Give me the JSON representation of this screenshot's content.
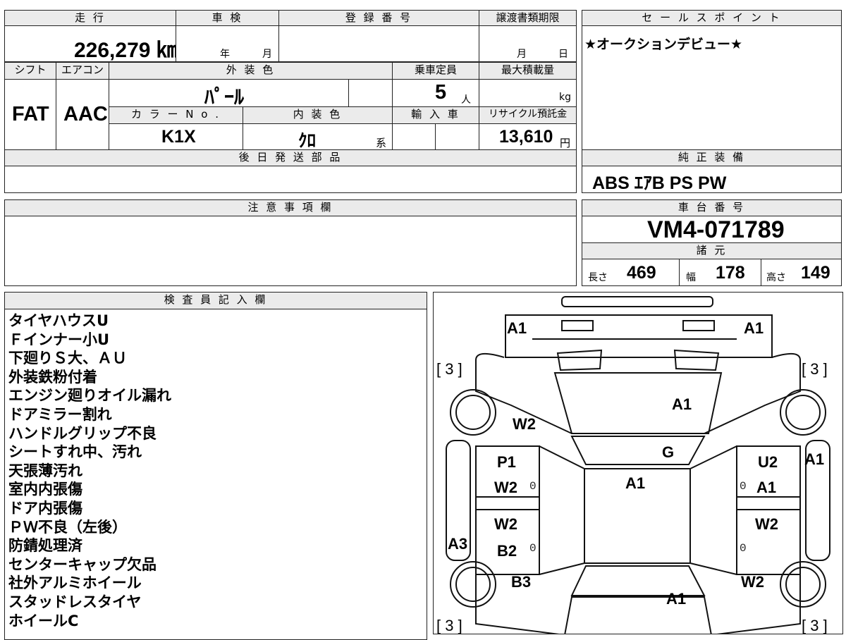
{
  "headers": {
    "mileage": "走 行",
    "inspection": "車 検",
    "registration": "登 録 番 号",
    "transfer_deadline": "譲渡書類期限",
    "sales_point": "セ ー ル ス ポ イ ン ト",
    "shift": "シフト",
    "aircon": "エアコン",
    "exterior_color": "外 装 色",
    "capacity": "乗車定員",
    "max_load": "最大積載量",
    "color_no": "カ ラ ー N o .",
    "interior_color": "内 装 色",
    "import": "輸 入 車",
    "recycle": "リサイクル預託金",
    "later_parts": "後 日 発 送 部 品",
    "genuine_equipment": "純 正 装 備",
    "notes": "注 意 事 項 欄",
    "chassis_no": "車 台 番 号",
    "specs": "諸 元",
    "inspector": "検 査 員 記 入 欄"
  },
  "vehicle": {
    "mileage": "226,279 ㎞",
    "inspection_year_unit": "年",
    "inspection_month_unit": "月",
    "deadline_month_unit": "月",
    "deadline_day_unit": "日",
    "shift": "FAT",
    "aircon": "AAC",
    "exterior_color": "ﾊﾟｰﾙ",
    "capacity": "5",
    "capacity_unit": "人",
    "max_load_unit": "kg",
    "color_no": "K1X",
    "interior_color": "ｸﾛ",
    "interior_suffix": "系",
    "recycle_fee": "13,610",
    "recycle_unit": "円",
    "sales_point": "★オークションデビュー★",
    "equipment": "ABS ｴｱB PS PW",
    "chassis_no": "VM4-071789",
    "length_label": "長さ",
    "length": "469",
    "width_label": "幅",
    "width": "178",
    "height_label": "高さ",
    "height": "149"
  },
  "inspector_notes": [
    "タイヤハウスU",
    "Ｆインナー小U",
    "下廻りＳ大、ＡＵ",
    "外装鉄粉付着",
    "エンジン廻りオイル漏れ",
    "ドアミラー割れ",
    "ハンドルグリップ不良",
    "シートすれ中、汚れ",
    "天張薄汚れ",
    "室内内張傷",
    "ドア内張傷",
    "ＰＷ不良（左後）",
    "防錆処理済",
    "センターキャップ欠品",
    "社外アルミホイール",
    "スタッドレスタイヤ",
    "ホイールC"
  ],
  "diagram": {
    "front_left": "A1",
    "front_right": "A1",
    "tire_fl": "[ 3 ]",
    "tire_fr": "[ 3 ]",
    "tire_rl": "[ 3 ]",
    "tire_rr": "[ 3 ]",
    "hood": "A1",
    "fender_left": "W2",
    "windshield": "G",
    "door_fl_a": "P1",
    "door_fl_b": "W2",
    "roof": "A1",
    "door_fr_a": "U2",
    "door_fr_b": "A1",
    "mirror_right": "A1",
    "door_rl_a": "W2",
    "door_rl_b": "B2",
    "door_rr": "W2",
    "rocker_left": "A3",
    "quarter_left": "B3",
    "quarter_right": "W2",
    "trunk": "A1",
    "zero": "0"
  }
}
